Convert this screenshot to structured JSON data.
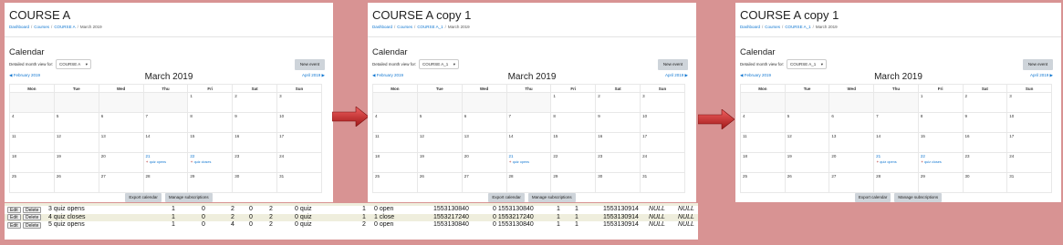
{
  "panels": [
    {
      "course_title": "COURSE A",
      "breadcrumb": [
        "Dashboard",
        "Courses",
        "COURSE A",
        "March 2019"
      ],
      "select_value": "COURSE A"
    },
    {
      "course_title": "COURSE A copy 1",
      "breadcrumb": [
        "Dashboard",
        "Courses",
        "COURSE A_1",
        "March 2019"
      ],
      "select_value": "COURSE A_1"
    },
    {
      "course_title": "COURSE A copy 1",
      "breadcrumb": [
        "Dashboard",
        "Courses",
        "COURSE A_1",
        "March 2019"
      ],
      "select_value": "COURSE A_1"
    }
  ],
  "calendar": {
    "heading": "Calendar",
    "view_label": "Detailed month view for:",
    "new_event": "New event",
    "prev_month": "February 2019",
    "next_month": "April 2019",
    "month": "March 2019",
    "weekdays": [
      "Mon",
      "Tue",
      "Wed",
      "Thu",
      "Fri",
      "Sat",
      "Sun"
    ],
    "weeks": [
      [
        "",
        "",
        "",
        "",
        "1",
        "2",
        "3"
      ],
      [
        "4",
        "5",
        "6",
        "7",
        "8",
        "9",
        "10"
      ],
      [
        "11",
        "12",
        "13",
        "14",
        "15",
        "16",
        "17"
      ],
      [
        "18",
        "19",
        "20",
        "21",
        "22",
        "23",
        "24"
      ],
      [
        "25",
        "26",
        "27",
        "28",
        "29",
        "30",
        "31"
      ]
    ],
    "export": "Export calendar",
    "manage": "Manage subscriptions"
  },
  "events": {
    "panel0": {
      "21": "quiz opens",
      "22": "quiz closes"
    },
    "panel1": {
      "21": "quiz opens"
    },
    "panel2": {
      "21": "quiz opens",
      "22": "quiz closes"
    }
  },
  "db_rows": [
    {
      "edit": "Edit",
      "delete": "Delete",
      "name": "3 quiz opens",
      "a": "1",
      "b": "0",
      "c": "2",
      "d": "0",
      "e": "2",
      "f": "0 quiz",
      "g": "1",
      "h": "0 open",
      "i": "1553130840",
      "j": "0 1553130840",
      "k": "1",
      "l": "1",
      "m": "1553130914",
      "n": "NULL",
      "o": "NULL"
    },
    {
      "edit": "Edit",
      "delete": "Delete",
      "name": "4 quiz closes",
      "a": "1",
      "b": "0",
      "c": "2",
      "d": "0",
      "e": "2",
      "f": "0 quiz",
      "g": "1",
      "h": "1 close",
      "i": "1553217240",
      "j": "0 1553217240",
      "k": "1",
      "l": "1",
      "m": "1553130914",
      "n": "NULL",
      "o": "NULL"
    },
    {
      "edit": "Edit",
      "delete": "Delete",
      "name": "5 quiz opens",
      "a": "1",
      "b": "0",
      "c": "4",
      "d": "0",
      "e": "2",
      "f": "0 quiz",
      "g": "2",
      "h": "0 open",
      "i": "1553130840",
      "j": "0 1553130840",
      "k": "1",
      "l": "1",
      "m": "1553130914",
      "n": "NULL",
      "o": "NULL"
    }
  ]
}
